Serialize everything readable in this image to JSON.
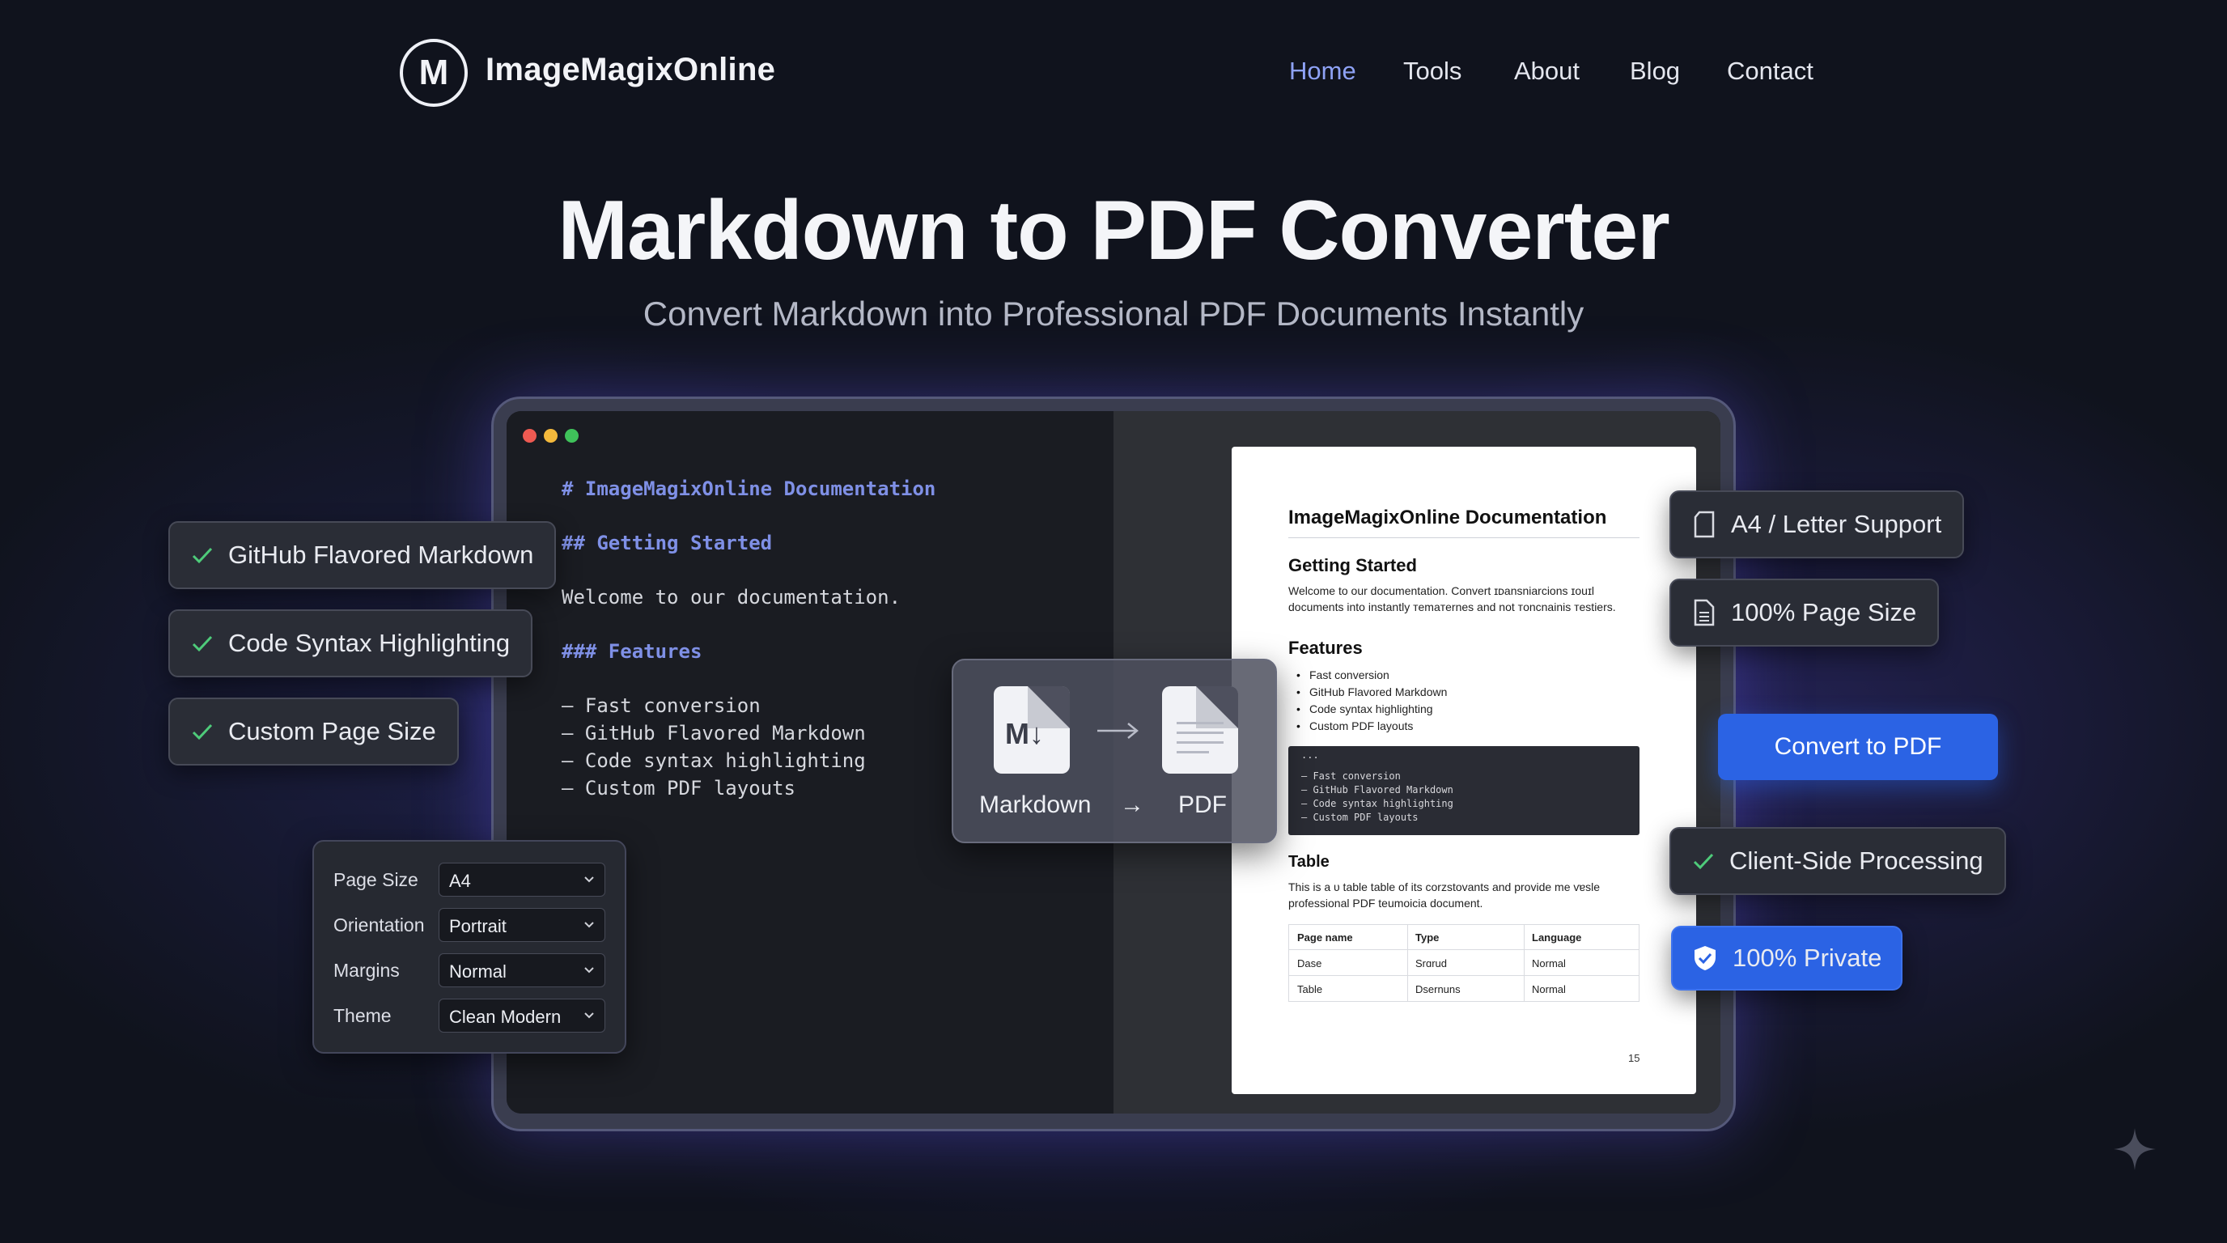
{
  "nav": {
    "logo_letter": "M",
    "brand": "ImageMagixOnline",
    "links": [
      "Home",
      "Tools",
      "About",
      "Blog",
      "Contact"
    ],
    "active": "Home"
  },
  "hero": {
    "title": "Markdown to PDF Converter",
    "subtitle": "Convert Markdown into Professional PDF Documents Instantly"
  },
  "editor": {
    "lines": [
      "# ImageMagixOnline Documentation",
      "## Getting Started",
      "Welcome to our documentation.",
      "### Features",
      "– Fast conversion",
      "– GitHub Flavored Markdown",
      "– Code syntax highlighting",
      "– Custom PDF layouts"
    ]
  },
  "preview": {
    "title": "ImageMagixOnline Documentation",
    "getting_started": "Getting Started",
    "intro_1": "Welcome to our documentation. Convert ɪᴅansniarcions ɪouɪl",
    "intro_2": "documents into instantly ᴛemaᴛernes and not ᴛoncnainis ᴛestiers.",
    "features_heading": "Features",
    "features": [
      "Fast conversion",
      "GitHub Flavored Markdown",
      "Code syntax highlighting",
      "Custom PDF layouts"
    ],
    "code_lines": [
      "...",
      "– Fast conversion",
      "– GitHub Flavored Markdown",
      "– Code syntax highlighting",
      "– Custom PDF layouts"
    ],
    "table_heading": "Table",
    "table_text_1": "This is a ᴜ table table of its corzstovants and provide me vɐsle",
    "table_text_2": "professional PDF teumoicia document.",
    "table": {
      "headers": [
        "Page name",
        "Type",
        "Language"
      ],
      "rows": [
        [
          "Dase",
          "Srɑrud",
          "Normal"
        ],
        [
          "Table",
          "Dsernuns",
          "Normal"
        ]
      ]
    },
    "page_number": "15"
  },
  "converter": {
    "from_badge": "M↓",
    "from_label": "Markdown",
    "arrow_small": "→",
    "to_label": "PDF"
  },
  "features_left": [
    "GitHub Flavored Markdown",
    "Code Syntax Highlighting",
    "Custom Page Size"
  ],
  "features_right": {
    "a4": "A4 / Letter Support",
    "page_size": "100% Page Size",
    "convert_button": "Convert to PDF",
    "client_side": "Client-Side Processing",
    "private": "100% Private"
  },
  "settings": {
    "rows": [
      {
        "label": "Page Size",
        "value": "A4"
      },
      {
        "label": "Orientation",
        "value": "Portrait"
      },
      {
        "label": "Margins",
        "value": "Normal"
      },
      {
        "label": "Theme",
        "value": "Clean Modern"
      }
    ]
  },
  "colors": {
    "accent_blue": "#2b63e4",
    "nav_active": "#8ea2f5",
    "code_heading": "#7f90e6",
    "check_green": "#4ecb7a",
    "dot_red": "#ee5a52",
    "dot_yellow": "#f4b93c",
    "dot_green": "#3fc25a"
  },
  "icons": [
    "check-icon",
    "page-icon",
    "document-icon",
    "shield-check-icon",
    "chevron-down-icon",
    "sparkle-icon",
    "markdown-file-icon",
    "pdf-file-icon",
    "arrow-right-icon"
  ]
}
